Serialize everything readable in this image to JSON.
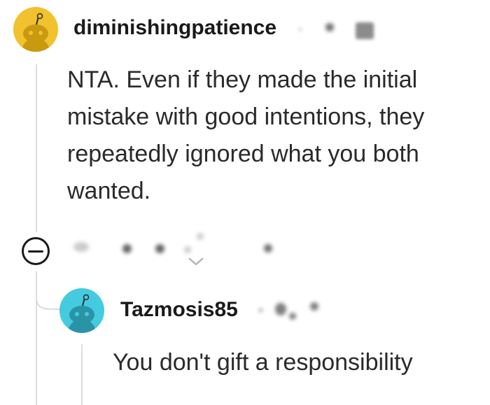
{
  "colors": {
    "avatar_1_bg": "#f2c12e",
    "avatar_2_bg": "#45cbe0",
    "thread_line": "#dcdcdc",
    "text": "#2a2a2a"
  },
  "comment_1": {
    "username": "diminishingpatience",
    "avatar_icon": "snoo-avatar-icon",
    "body": "NTA. Even if they made the initial mistake with good intentions, they repeatedly ignored what you both wanted."
  },
  "comment_2": {
    "username": "Tazmosis85",
    "avatar_icon": "snoo-avatar-icon",
    "body": "You don't gift a responsibility"
  },
  "controls": {
    "collapse_icon": "collapse-minus-icon",
    "expand_icon": "chevron-down-icon"
  }
}
